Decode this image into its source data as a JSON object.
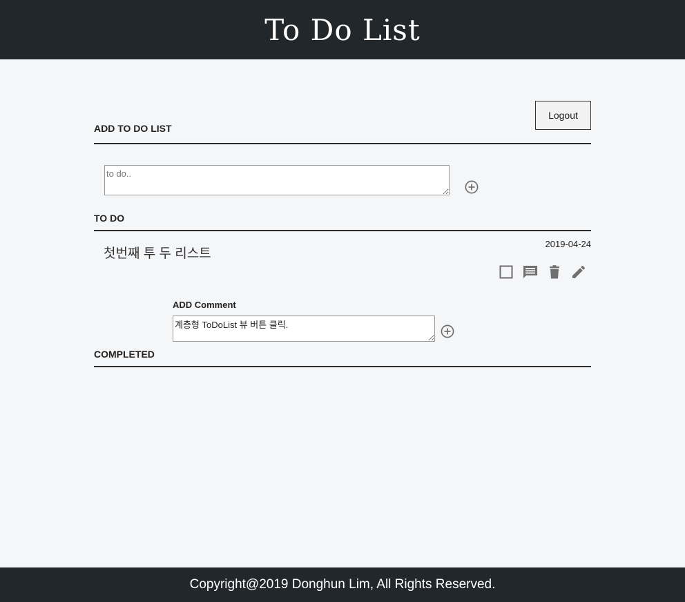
{
  "header": {
    "title": "To Do List"
  },
  "auth": {
    "logout_label": "Logout"
  },
  "add_section": {
    "title": "ADD TO DO LIST",
    "input_placeholder": "to do.."
  },
  "todo_section": {
    "title": "TO DO",
    "items": [
      {
        "text": "첫번째 투 두 리스트",
        "date": "2019-04-24",
        "actions": [
          "checkbox-icon",
          "comment-icon",
          "trash-icon",
          "edit-icon"
        ],
        "comment_form": {
          "label": "ADD Comment",
          "value": "계층형 ToDoList 뷰 버튼 클릭."
        }
      }
    ]
  },
  "completed_section": {
    "title": "COMPLETED"
  },
  "footer": {
    "text": "Copyright@2019 Donghun Lim, All Rights Reserved."
  },
  "colors": {
    "header_bg": "#22272c",
    "page_bg": "#f5f6f8",
    "icon": "#6f6f6f"
  }
}
